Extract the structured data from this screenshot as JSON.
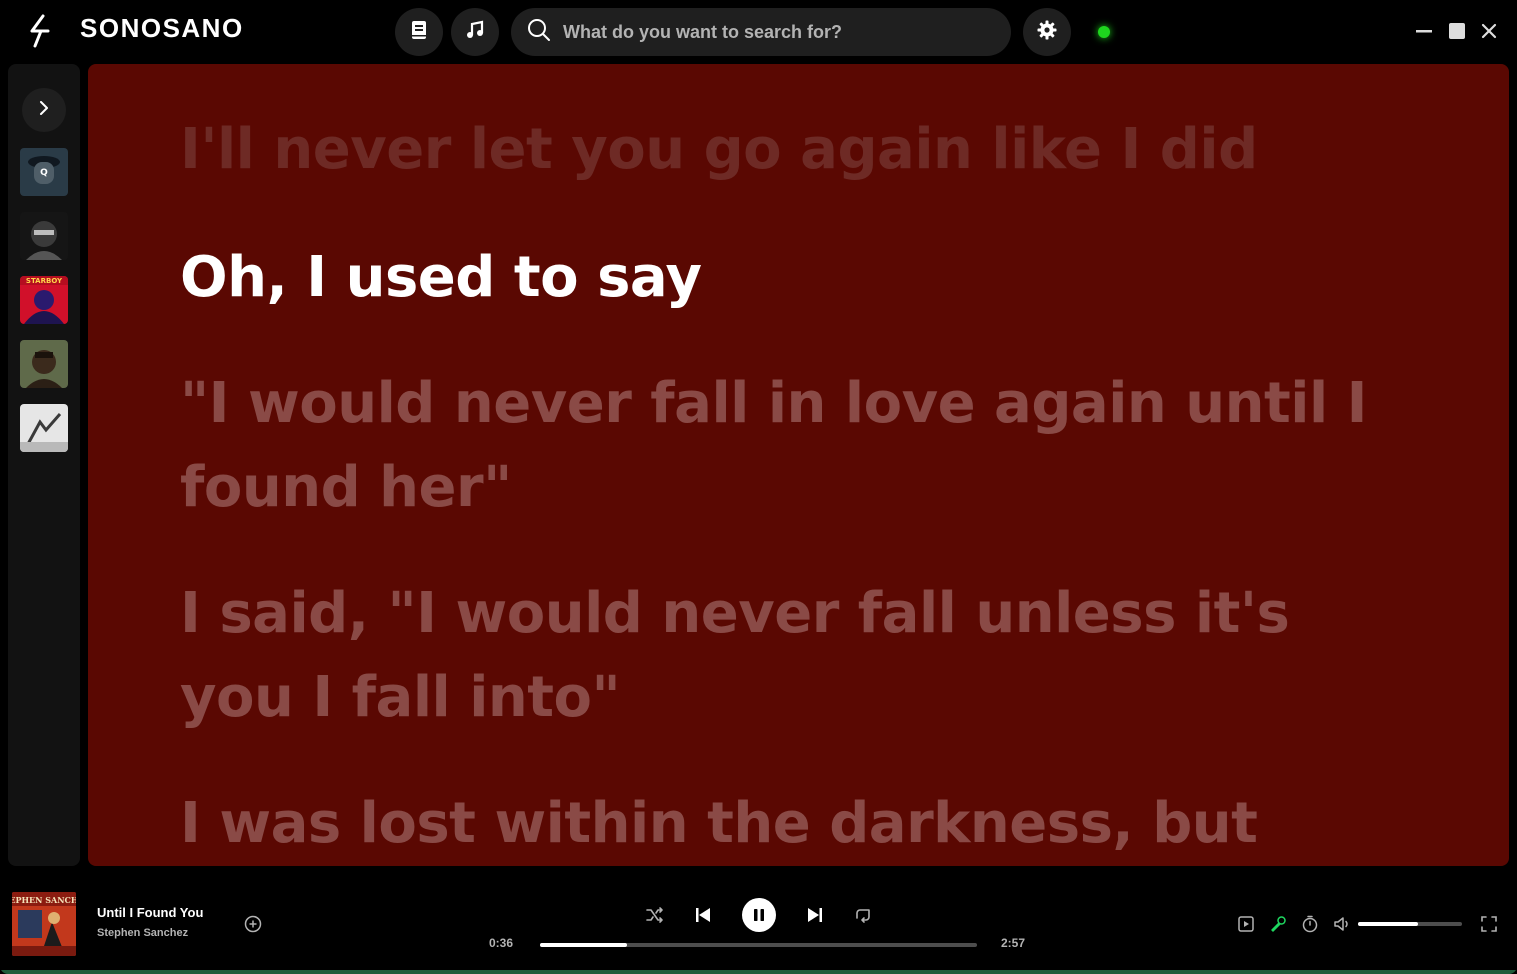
{
  "app": {
    "name": "SONOSANO",
    "accent_color": "#1ed51e"
  },
  "header": {
    "search_placeholder": "What do you want to search for?",
    "library_icon": "book-icon",
    "music_icon": "music-note-icon",
    "settings_icon": "gear-icon",
    "status": "online"
  },
  "sidebar": {
    "toggle_icon": "chevron-right-icon",
    "albums": [
      {
        "name": "album-1",
        "colors": [
          "#2a3b47",
          "#5d6f7a"
        ]
      },
      {
        "name": "album-2",
        "colors": [
          "#151515",
          "#8a8a8a"
        ]
      },
      {
        "name": "album-3",
        "colors": [
          "#d1102a",
          "#2a1a6e"
        ]
      },
      {
        "name": "album-4",
        "colors": [
          "#3b2a1c",
          "#8c8a5a"
        ]
      },
      {
        "name": "album-5",
        "colors": [
          "#e6e6e6",
          "#6f6f6f"
        ]
      }
    ]
  },
  "lyrics": {
    "background": "#5a0802",
    "lines": [
      "I'll never let you go again like I did",
      "Oh, I used to say",
      "\"I would never fall in love again until I found her\"",
      "I said, \"I would never fall unless it's you I fall into\"",
      "I was lost within the darkness, but then I"
    ],
    "active_index": 1
  },
  "now_playing": {
    "title": "Until I Found You",
    "artist": "Stephen Sanchez",
    "current_time": "0:36",
    "duration": "2:57",
    "progress": 0.2,
    "is_playing": true
  },
  "controls": {
    "shuffle_icon": "shuffle-icon",
    "prev_icon": "skip-previous-icon",
    "pause_icon": "pause-icon",
    "next_icon": "skip-next-icon",
    "repeat_icon": "repeat-icon"
  },
  "extras": {
    "queue_icon": "queue-icon",
    "lyrics_icon": "microphone-icon",
    "timer_icon": "timer-icon",
    "volume_icon": "volume-icon",
    "volume_level": 0.58,
    "fullscreen_icon": "fullscreen-icon"
  }
}
